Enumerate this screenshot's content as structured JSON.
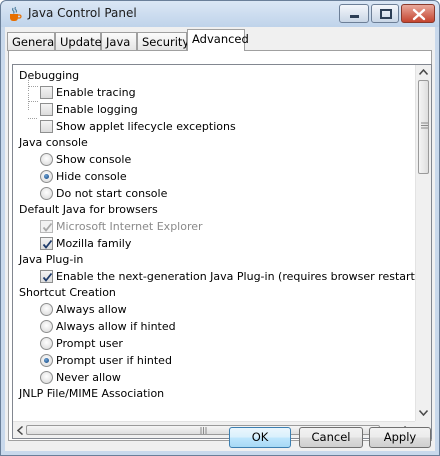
{
  "window": {
    "title": "Java Control Panel",
    "accent": "#3c7fb1"
  },
  "tabs": [
    {
      "label": "General",
      "active": false
    },
    {
      "label": "Update",
      "active": false
    },
    {
      "label": "Java",
      "active": false
    },
    {
      "label": "Security",
      "active": false
    },
    {
      "label": "Advanced",
      "active": true
    }
  ],
  "settings": {
    "debugging": {
      "header": "Debugging",
      "items": [
        {
          "label": "Enable tracing",
          "type": "checkbox",
          "checked": false
        },
        {
          "label": "Enable logging",
          "type": "checkbox",
          "checked": false
        },
        {
          "label": "Show applet lifecycle exceptions",
          "type": "checkbox",
          "checked": false
        }
      ]
    },
    "java_console": {
      "header": "Java console",
      "items": [
        {
          "label": "Show console",
          "type": "radio",
          "checked": false
        },
        {
          "label": "Hide console",
          "type": "radio",
          "checked": true
        },
        {
          "label": "Do not start console",
          "type": "radio",
          "checked": false
        }
      ]
    },
    "default_java": {
      "header": "Default Java for browsers",
      "items": [
        {
          "label": "Microsoft Internet Explorer",
          "type": "checkbox",
          "checked": true,
          "disabled": true
        },
        {
          "label": "Mozilla family",
          "type": "checkbox",
          "checked": true
        }
      ]
    },
    "plugin": {
      "header": "Java Plug-in",
      "items": [
        {
          "label": "Enable the next-generation Java Plug-in (requires browser restart)",
          "type": "checkbox",
          "checked": true
        }
      ]
    },
    "shortcut": {
      "header": "Shortcut Creation",
      "items": [
        {
          "label": "Always allow",
          "type": "radio",
          "checked": false
        },
        {
          "label": "Always allow if hinted",
          "type": "radio",
          "checked": false
        },
        {
          "label": "Prompt user",
          "type": "radio",
          "checked": false
        },
        {
          "label": "Prompt user if hinted",
          "type": "radio",
          "checked": true
        },
        {
          "label": "Never allow",
          "type": "radio",
          "checked": false
        }
      ]
    },
    "jnlp": {
      "header": "JNLP File/MIME Association"
    }
  },
  "buttons": {
    "ok": "OK",
    "cancel": "Cancel",
    "apply": "Apply"
  }
}
